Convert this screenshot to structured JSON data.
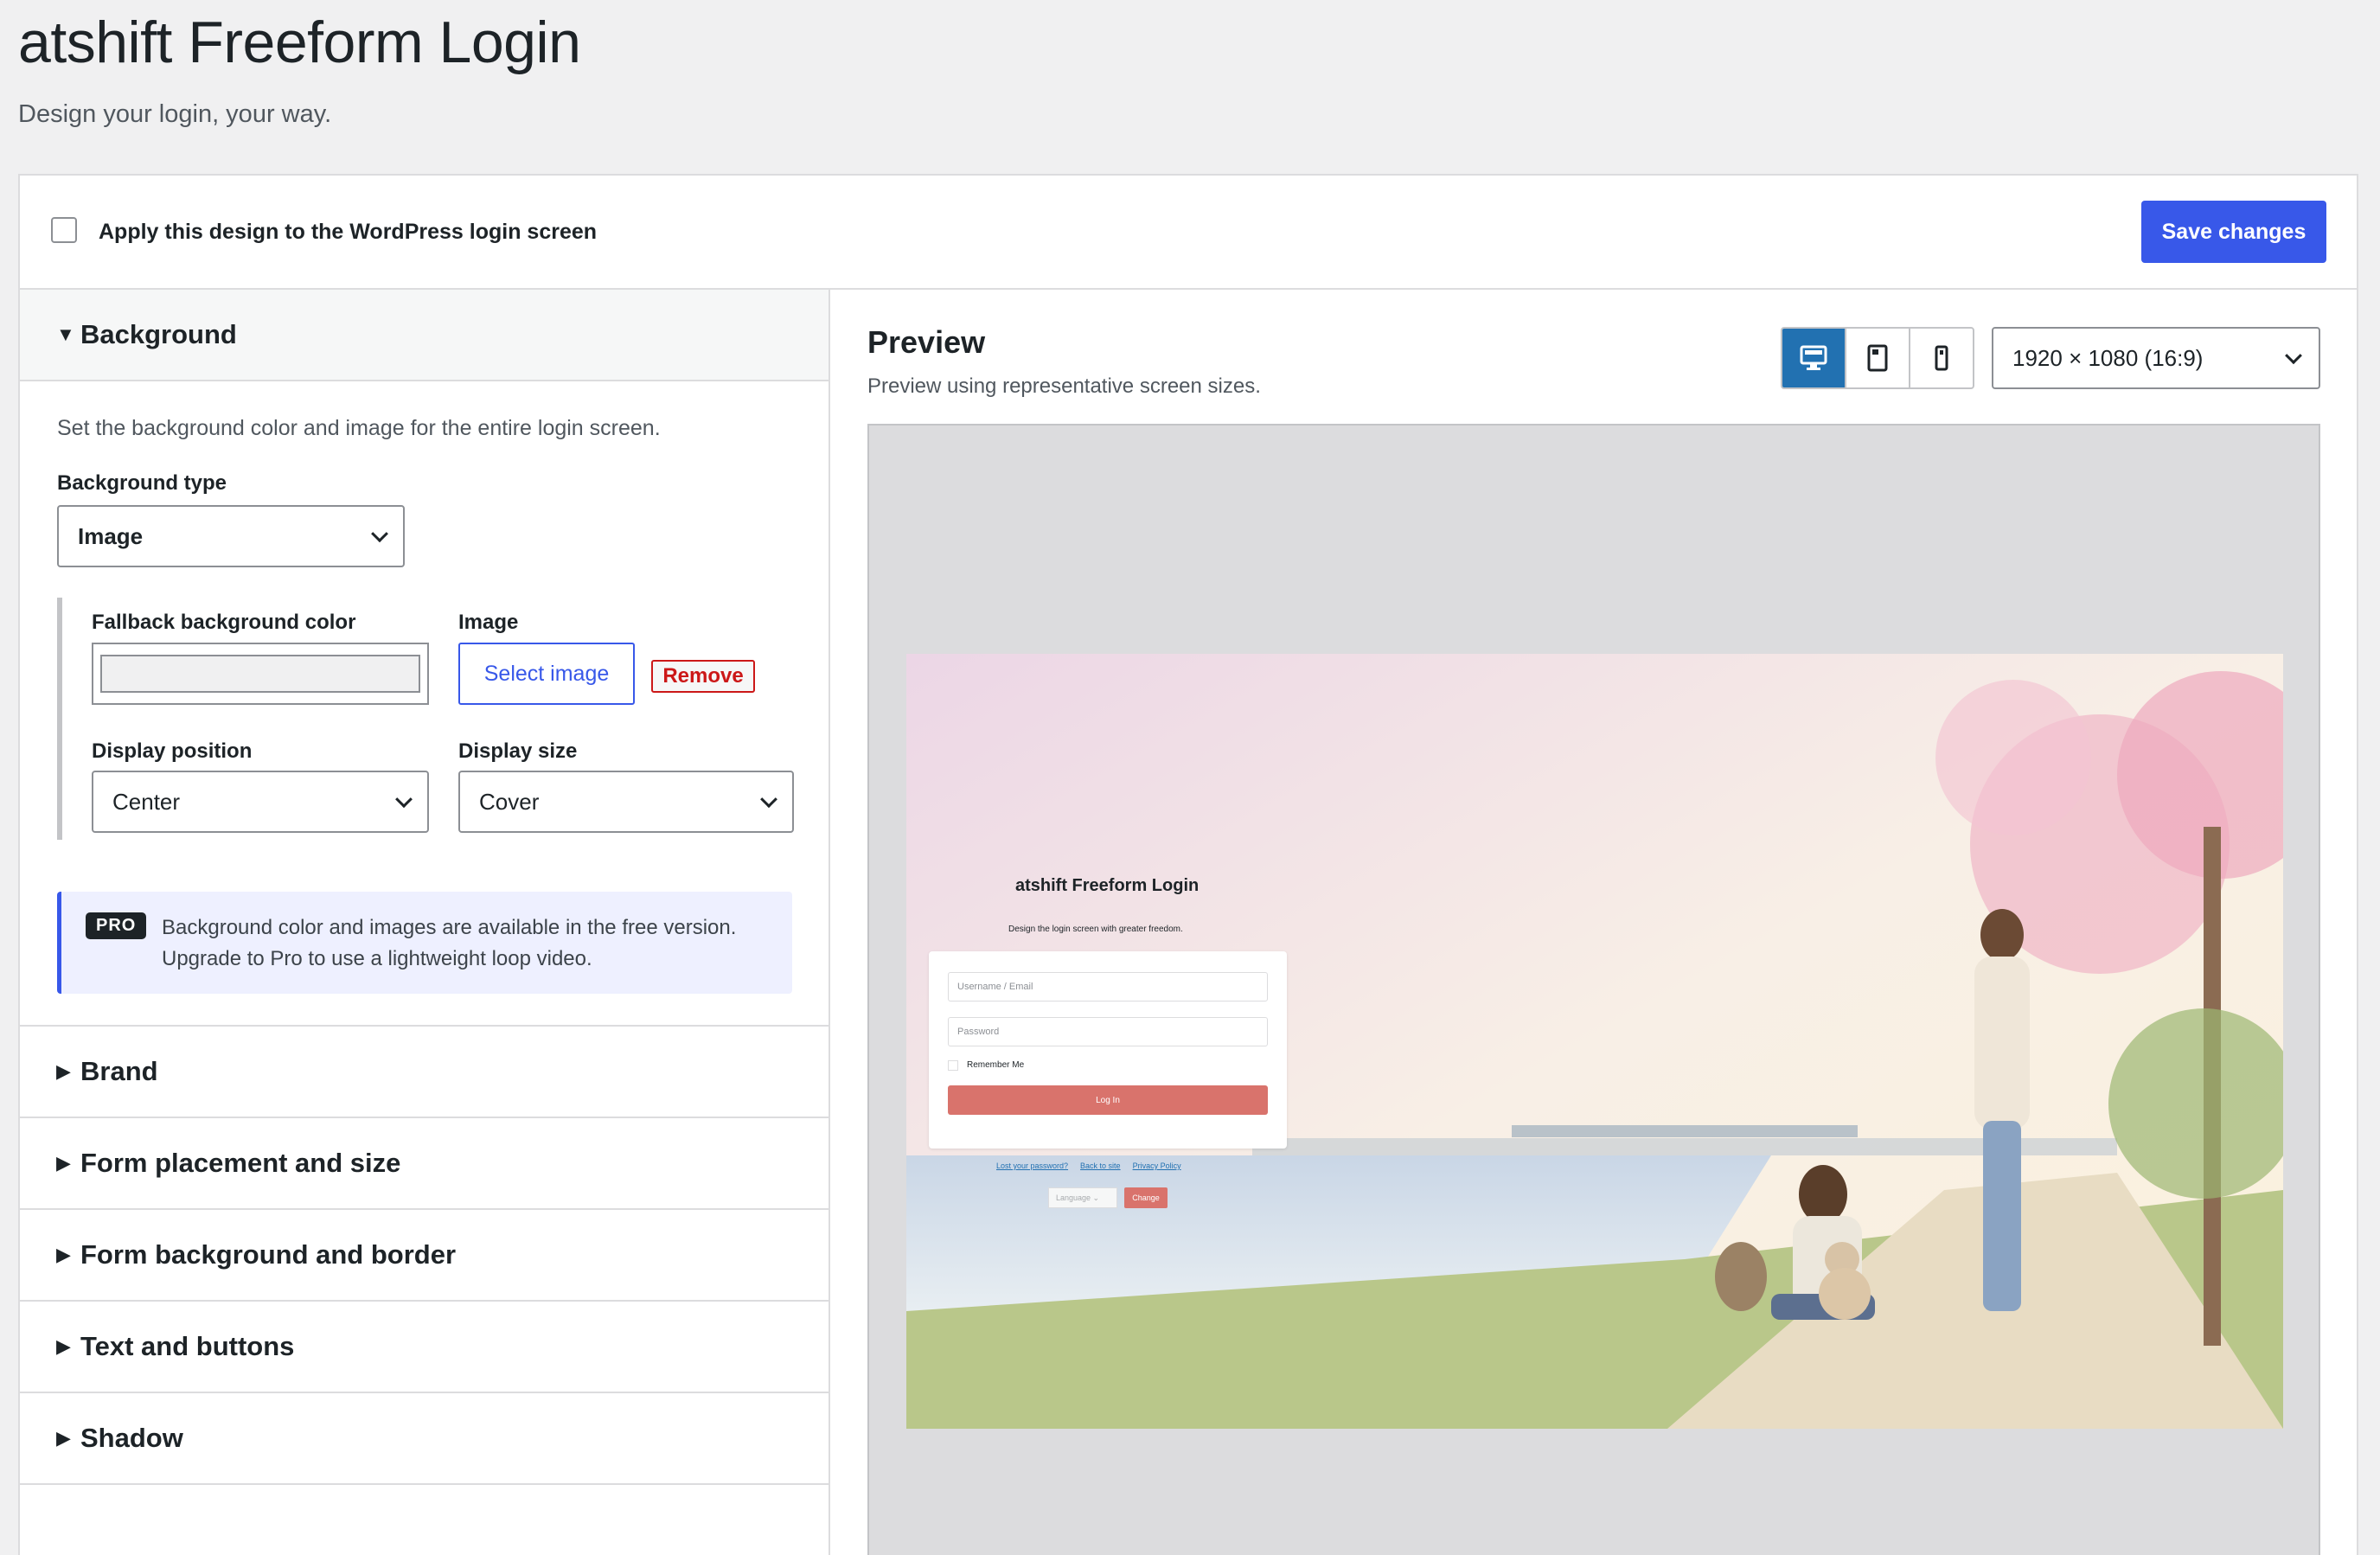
{
  "header": {
    "title": "atshift Freeform Login",
    "subtitle": "Design your login, your way."
  },
  "topbar": {
    "apply_label": "Apply this design to the WordPress login screen",
    "apply_checked": false,
    "save_label": "Save changes"
  },
  "sections": {
    "background": {
      "title": "Background",
      "description": "Set the background color and image for the entire login screen.",
      "type_label": "Background type",
      "type_value": "Image",
      "fallback_label": "Fallback background color",
      "image_label": "Image",
      "select_image_label": "Select image",
      "remove_label": "Remove",
      "position_label": "Display position",
      "position_value": "Center",
      "size_label": "Display size",
      "size_value": "Cover",
      "notice_badge": "PRO",
      "notice_line1": "Background color and images are available in the free version.",
      "notice_line2": "Upgrade to Pro to use a lightweight loop video."
    },
    "collapsed": [
      {
        "title": "Brand"
      },
      {
        "title": "Form placement and size"
      },
      {
        "title": "Form background and border"
      },
      {
        "title": "Text and buttons"
      },
      {
        "title": "Shadow"
      }
    ]
  },
  "preview": {
    "title": "Preview",
    "subtitle": "Preview using representative screen sizes.",
    "devices": [
      "desktop-icon",
      "tablet-icon",
      "mobile-icon"
    ],
    "active_device": "desktop",
    "size_value": "1920 × 1080 (16:9)",
    "screen": {
      "login_title": "atshift Freeform Login",
      "login_tagline": "Design the login screen with greater freedom.",
      "username_placeholder": "Username / Email",
      "password_placeholder": "Password",
      "remember_label": "Remember Me",
      "login_button": "Log In",
      "links": [
        "Lost your password?",
        "Back to site",
        "Privacy Policy"
      ],
      "language_label": "Language",
      "change_button": "Change"
    }
  },
  "colors": {
    "accent": "#3858e9",
    "active_device": "#2271b1",
    "remove": "#cc1818",
    "login_button": "#d9736c"
  }
}
